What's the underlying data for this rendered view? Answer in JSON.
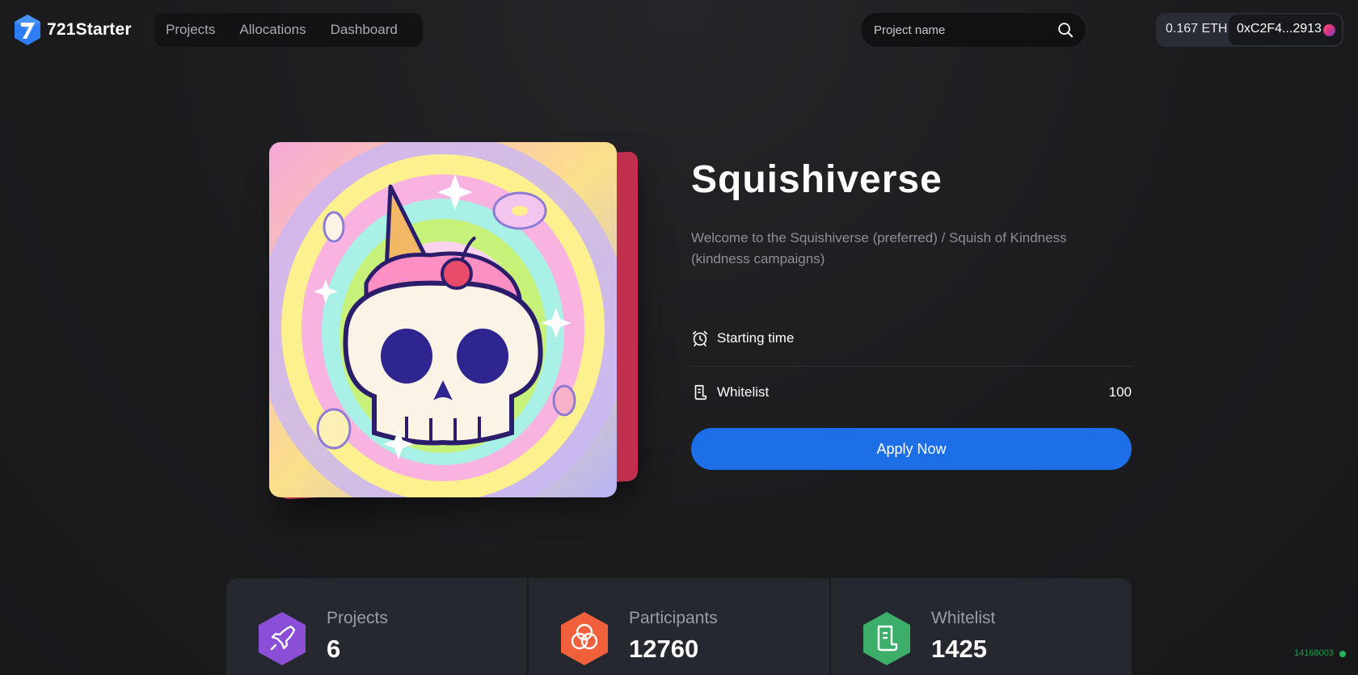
{
  "header": {
    "logo_text": "721Starter",
    "nav": [
      "Projects",
      "Allocations",
      "Dashboard"
    ],
    "search_placeholder": "Project name",
    "balance": "0.167 ETH",
    "address": "0xC2F4...2913"
  },
  "project": {
    "title": "Squishiverse",
    "description": "Welcome to the Squishiverse (preferred) / Squish of Kindness (kindness campaigns)",
    "starting_time_label": "Starting time",
    "whitelist_label": "Whitelist",
    "whitelist_value": "100",
    "apply_label": "Apply Now"
  },
  "stats": [
    {
      "label": "Projects",
      "value": "6",
      "color": "#8a4fd6",
      "icon": "rocket-icon"
    },
    {
      "label": "Participants",
      "value": "12760",
      "color": "#f0603a",
      "icon": "rings-icon"
    },
    {
      "label": "Whitelist",
      "value": "1425",
      "color": "#3dae6a",
      "icon": "scroll-icon"
    }
  ],
  "footer": {
    "block_number": "14168003"
  },
  "colors": {
    "accent": "#1c6fe6",
    "art_backdrop": "#c0304d",
    "status_green": "#23b553"
  }
}
